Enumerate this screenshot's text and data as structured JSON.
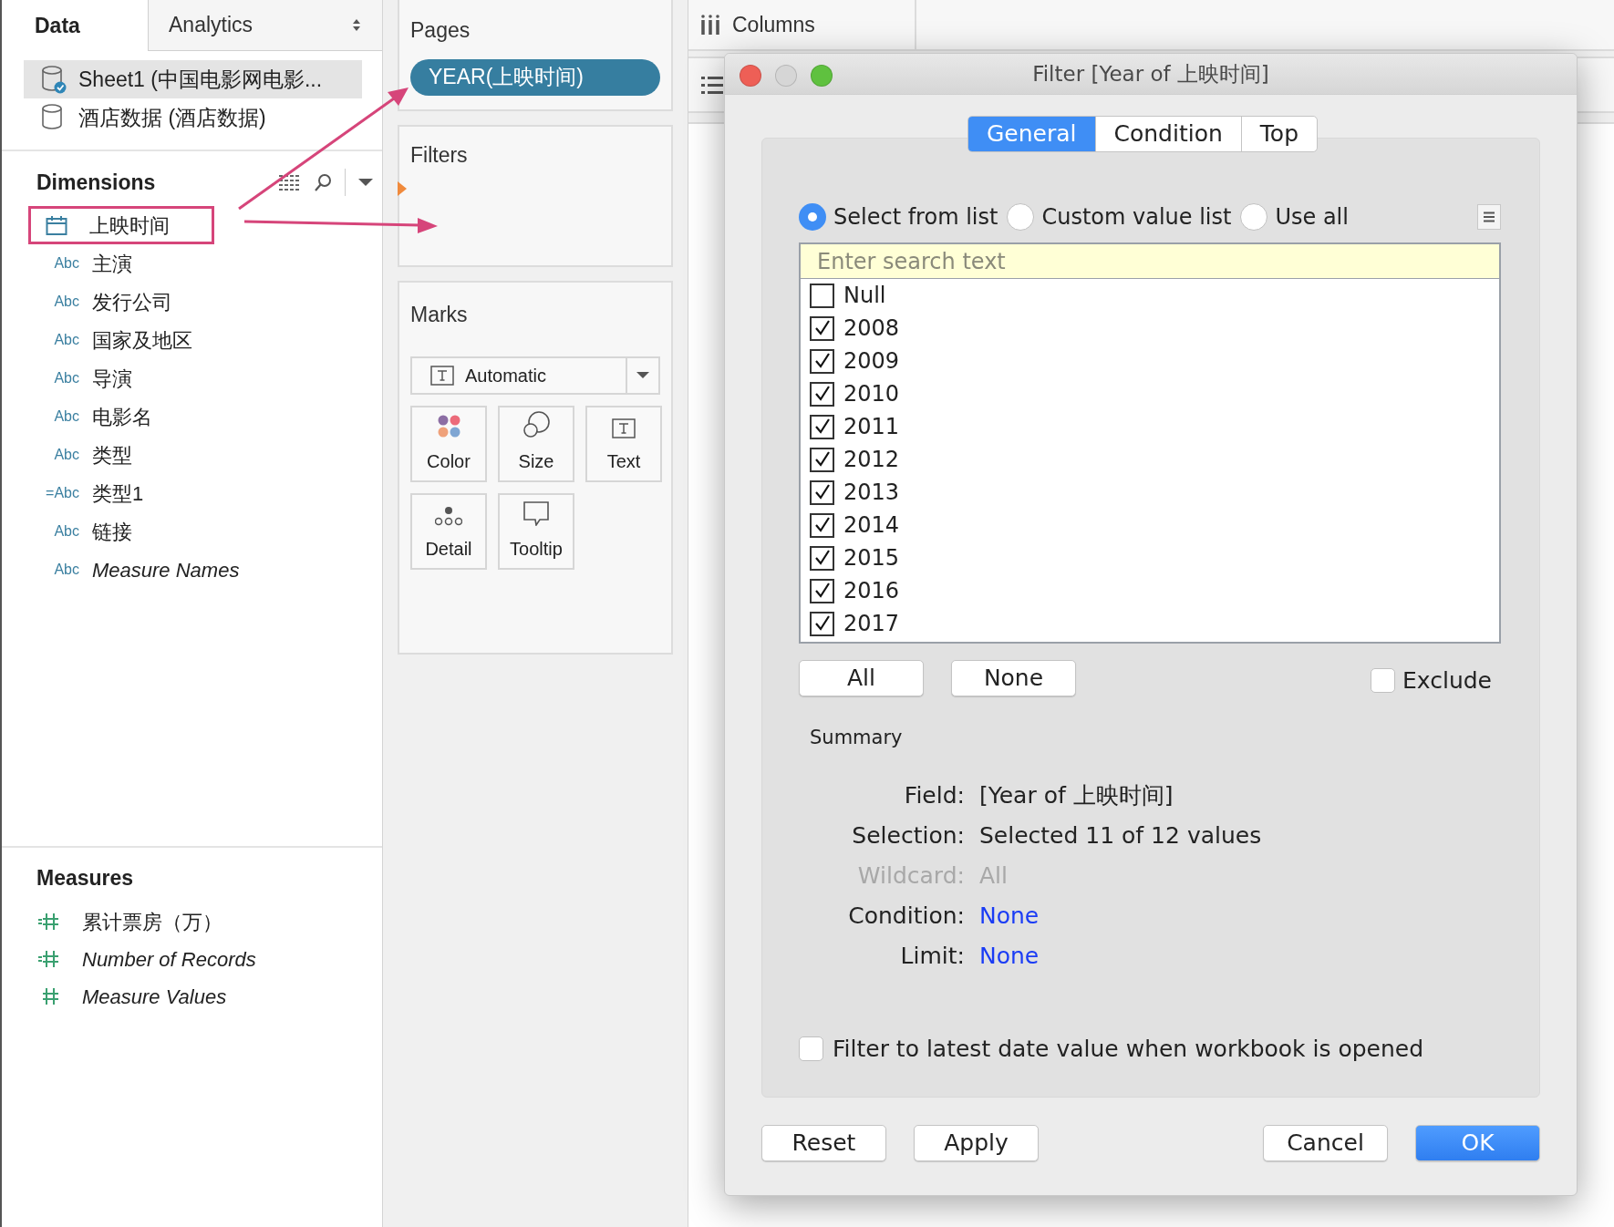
{
  "data_pane": {
    "tabs": [
      {
        "label": "Data",
        "selected": true
      },
      {
        "label": "Analytics",
        "selected": false
      }
    ],
    "data_sources": [
      {
        "name": "Sheet1 (中国电影网电影...",
        "selected": true,
        "connected": true
      },
      {
        "name": "酒店数据 (酒店数据)",
        "selected": false,
        "connected": false
      }
    ],
    "dimensions": {
      "title": "Dimensions",
      "items": [
        {
          "kind": "date",
          "name": "上映时间",
          "highlighted": true,
          "italic": false
        },
        {
          "kind": "string",
          "type_label": "Abc",
          "name": "主演",
          "highlighted": false,
          "italic": false
        },
        {
          "kind": "string",
          "type_label": "Abc",
          "name": "发行公司",
          "highlighted": false,
          "italic": false
        },
        {
          "kind": "string",
          "type_label": "Abc",
          "name": "国家及地区",
          "highlighted": false,
          "italic": false
        },
        {
          "kind": "string",
          "type_label": "Abc",
          "name": "导演",
          "highlighted": false,
          "italic": false
        },
        {
          "kind": "string",
          "type_label": "Abc",
          "name": "电影名",
          "highlighted": false,
          "italic": false
        },
        {
          "kind": "string",
          "type_label": "Abc",
          "name": "类型",
          "highlighted": false,
          "italic": false
        },
        {
          "kind": "string",
          "type_label": "=Abc",
          "name": "类型1",
          "highlighted": false,
          "italic": false
        },
        {
          "kind": "string",
          "type_label": "Abc",
          "name": "链接",
          "highlighted": false,
          "italic": false
        },
        {
          "kind": "string",
          "type_label": "Abc",
          "name": "Measure Names",
          "highlighted": false,
          "italic": true
        }
      ]
    },
    "measures": {
      "title": "Measures",
      "items": [
        {
          "kind": "calc_measure",
          "name": "累计票房（万）",
          "italic": false
        },
        {
          "kind": "calc_measure",
          "name": "Number of Records",
          "italic": true
        },
        {
          "kind": "measure",
          "name": "Measure Values",
          "italic": true
        }
      ]
    }
  },
  "pages": {
    "title": "Pages",
    "pills": [
      "YEAR(上映时间)"
    ]
  },
  "filters": {
    "title": "Filters"
  },
  "marks": {
    "title": "Marks",
    "mark_type": "Automatic",
    "cards": [
      {
        "kind": "color",
        "label": "Color"
      },
      {
        "kind": "size",
        "label": "Size"
      },
      {
        "kind": "text",
        "label": "Text"
      },
      {
        "kind": "detail",
        "label": "Detail"
      },
      {
        "kind": "tooltip",
        "label": "Tooltip"
      }
    ]
  },
  "columns_shelf": {
    "label": "Columns"
  },
  "dialog": {
    "title": "Filter [Year of 上映时间]",
    "tabs": [
      {
        "label": "General",
        "selected": true
      },
      {
        "label": "Condition",
        "selected": false
      },
      {
        "label": "Top",
        "selected": false
      }
    ],
    "modes": [
      {
        "label": "Select from list",
        "selected": true
      },
      {
        "label": "Custom value list",
        "selected": false
      },
      {
        "label": "Use all",
        "selected": false
      }
    ],
    "search": {
      "placeholder": "Enter search text"
    },
    "values": [
      {
        "label": "Null",
        "checked": false
      },
      {
        "label": "2008",
        "checked": true
      },
      {
        "label": "2009",
        "checked": true
      },
      {
        "label": "2010",
        "checked": true
      },
      {
        "label": "2011",
        "checked": true
      },
      {
        "label": "2012",
        "checked": true
      },
      {
        "label": "2013",
        "checked": true
      },
      {
        "label": "2014",
        "checked": true
      },
      {
        "label": "2015",
        "checked": true
      },
      {
        "label": "2016",
        "checked": true
      },
      {
        "label": "2017",
        "checked": true
      }
    ],
    "list_buttons": [
      "All",
      "None"
    ],
    "exclude": {
      "label": "Exclude",
      "checked": false
    },
    "summary": {
      "title": "Summary",
      "rows": [
        {
          "label": "Field:",
          "value": "[Year of 上映时间]",
          "disabled": false,
          "link": false
        },
        {
          "label": "Selection:",
          "value": "Selected 11 of 12 values",
          "disabled": false,
          "link": false
        },
        {
          "label": "Wildcard:",
          "value": "All",
          "disabled": true,
          "link": false
        },
        {
          "label": "Condition:",
          "value": "None",
          "disabled": false,
          "link": true
        },
        {
          "label": "Limit:",
          "value": "None",
          "disabled": false,
          "link": true
        }
      ]
    },
    "latest_option": {
      "label": "Filter to latest date value when workbook is opened",
      "checked": false
    },
    "footer_buttons": [
      {
        "label": "Reset",
        "primary": false
      },
      {
        "label": "Apply",
        "primary": false
      },
      {
        "label": "Cancel",
        "primary": false
      },
      {
        "label": "OK",
        "primary": true
      }
    ]
  }
}
